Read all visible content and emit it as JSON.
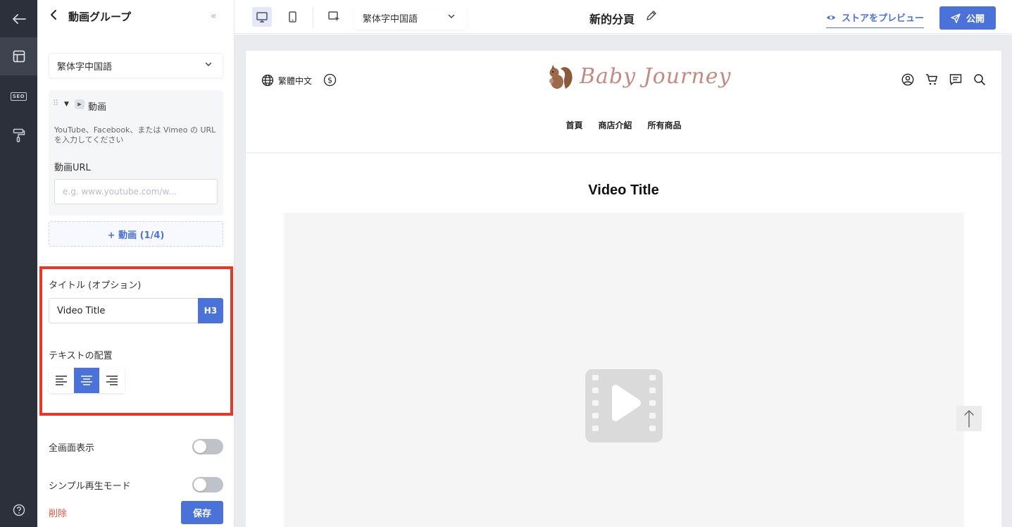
{
  "rail": {
    "items": [
      {
        "name": "back-arrow-icon"
      },
      {
        "name": "layout-icon"
      },
      {
        "name": "seo-icon",
        "label": "SEO"
      },
      {
        "name": "paint-roller-icon"
      },
      {
        "name": "help-icon"
      }
    ]
  },
  "panel": {
    "title": "動画グループ",
    "language_select": "繁体字中国語",
    "video_item": {
      "label": "動画",
      "hint": "YouTube、Facebook、または Vimeo の URL を入力してください",
      "url_label": "動画URL",
      "url_placeholder": "e.g. www.youtube.com/w...",
      "url_value": ""
    },
    "add_video_label": "+ 動画 (1/4)",
    "title_field_label": "タイトル (オプション)",
    "title_value": "Video Title",
    "heading_level": "H3",
    "text_align_label": "テキストの配置",
    "text_align_selected": "center",
    "fullscreen_label": "全画面表示",
    "fullscreen_on": false,
    "simple_mode_label": "シンプル再生モード",
    "simple_mode_on": false,
    "delete_label": "削除",
    "save_label": "保存"
  },
  "topbar": {
    "language_select": "繁体字中国語",
    "page_name": "新的分頁",
    "preview_label": "ストアをプレビュー",
    "publish_label": "公開",
    "active_device": "desktop"
  },
  "site": {
    "language_label": "繁體中文",
    "logo_text": "Baby Journey",
    "nav": [
      "首頁",
      "商店介紹",
      "所有商品"
    ],
    "video_title": "Video Title"
  },
  "colors": {
    "accent": "#4a72d8",
    "highlight": "#e63727",
    "rail_bg": "#2b303b",
    "logo": "#c48a82"
  }
}
